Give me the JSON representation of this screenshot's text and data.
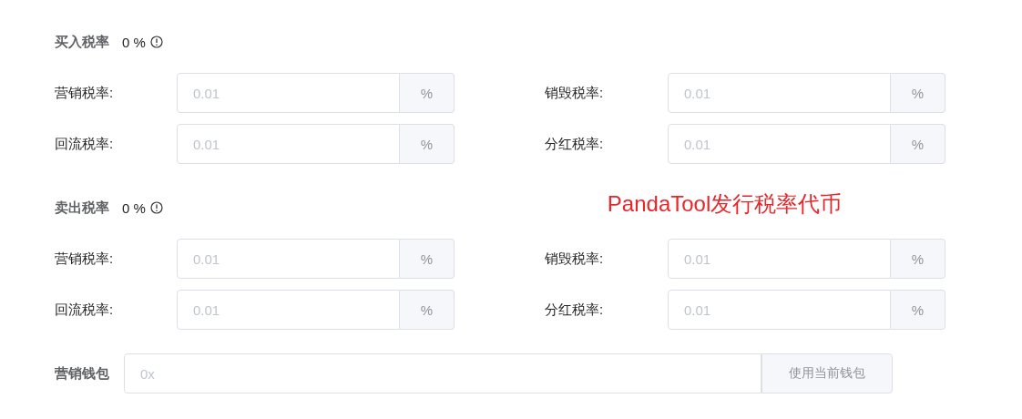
{
  "sections": [
    {
      "title": "买入税率",
      "rate": "0 %",
      "rows": [
        {
          "left": {
            "label": "营销税率:",
            "placeholder": "0.01",
            "unit": "%"
          },
          "right": {
            "label": "销毁税率:",
            "placeholder": "0.01",
            "unit": "%"
          }
        },
        {
          "left": {
            "label": "回流税率:",
            "placeholder": "0.01",
            "unit": "%"
          },
          "right": {
            "label": "分红税率:",
            "placeholder": "0.01",
            "unit": "%"
          }
        }
      ]
    },
    {
      "title": "卖出税率",
      "rate": "0 %",
      "caption": "PandaTool发行税率代币",
      "rows": [
        {
          "left": {
            "label": "营销税率:",
            "placeholder": "0.01",
            "unit": "%"
          },
          "right": {
            "label": "销毁税率:",
            "placeholder": "0.01",
            "unit": "%"
          }
        },
        {
          "left": {
            "label": "回流税率:",
            "placeholder": "0.01",
            "unit": "%"
          },
          "right": {
            "label": "分红税率:",
            "placeholder": "0.01",
            "unit": "%"
          }
        }
      ]
    }
  ],
  "wallet": {
    "label": "营销钱包",
    "placeholder": "0x",
    "button": "使用当前钱包"
  }
}
